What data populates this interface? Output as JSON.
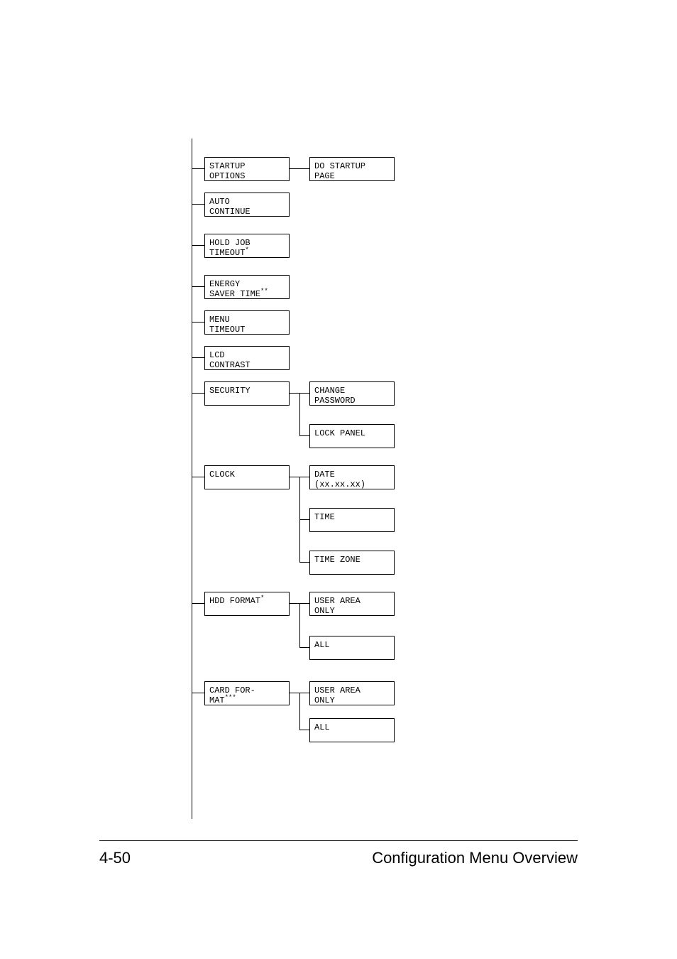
{
  "footer": {
    "page": "4-50",
    "title": "Configuration Menu Overview"
  },
  "col1": {
    "startup": "STARTUP\nOPTIONS",
    "auto": "AUTO\nCONTINUE",
    "hold_pre": "HOLD JOB\nTIMEOUT",
    "energy_pre": "ENERGY\nSAVER TIME",
    "menu": "MENU\nTIMEOUT",
    "lcd": "LCD\nCONTRAST",
    "security": "SECURITY",
    "clock": "CLOCK",
    "hdd_pre": "HDD FORMAT",
    "card_pre": "CARD FOR-\nMAT"
  },
  "col2": {
    "dostartup": "DO STARTUP\nPAGE",
    "change": "CHANGE\nPASSWORD",
    "lockpanel": "LOCK PANEL",
    "date": "DATE\n(xx.xx.xx)",
    "time": "TIME",
    "timezone": "TIME ZONE",
    "userarea1": "USER AREA\nONLY",
    "all1": "ALL",
    "userarea2": "USER AREA\nONLY",
    "all2": "ALL"
  },
  "marks": {
    "star1": "*",
    "star2": "**",
    "star3": "***"
  }
}
